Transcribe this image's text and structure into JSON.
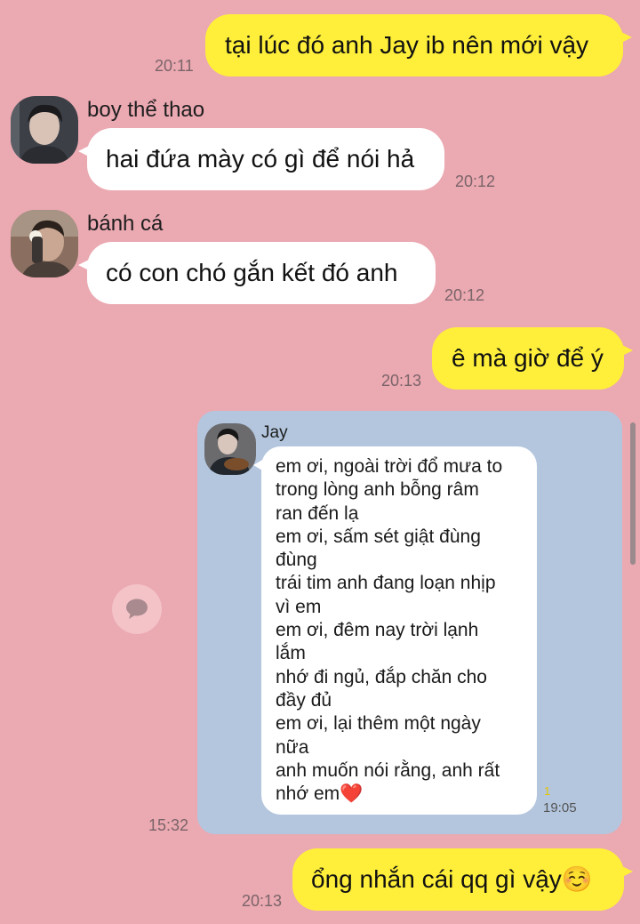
{
  "messages": [
    {
      "side": "me",
      "text": "tại lúc đó anh Jay ib nên mới vậy",
      "time": "20:11"
    },
    {
      "side": "them",
      "sender": "boy thể thao",
      "text": "hai đứa mày có gì để nói hả",
      "time": "20:12"
    },
    {
      "side": "them",
      "sender": "bánh cá",
      "text": "có con chó gắn kết đó anh",
      "time": "20:12"
    },
    {
      "side": "me",
      "text": "ê mà giờ để ý",
      "time": "20:13"
    },
    {
      "side": "me",
      "text": "ổng nhắn cái qq gì vậy☺️",
      "time": "20:13"
    }
  ],
  "shared_card": {
    "time_outer": "15:32",
    "sender": "Jay",
    "lines": [
      "em ơi, ngoài trời đổ mưa to",
      "trong lòng anh bỗng râm",
      "ran đến lạ",
      "em ơi, sấm sét giật đùng",
      "đùng",
      "trái tim anh đang loạn nhịp",
      "vì em",
      "em ơi, đêm nay trời lạnh",
      "lắm",
      "nhớ đi ngủ, đắp chăn cho",
      "đầy đủ",
      "em ơi, lại thêm một ngày",
      "nữa",
      "anh muốn nói rằng, anh rất"
    ],
    "last_line": "nhớ em",
    "heart": "❤️",
    "read_count": "1",
    "time_inner": "19:05"
  },
  "icons": {
    "share": "speech-bubble-icon"
  },
  "colors": {
    "background": "#eba9b2",
    "my_bubble": "#ffef3a",
    "their_bubble": "#ffffff",
    "card": "#b3c6de"
  }
}
